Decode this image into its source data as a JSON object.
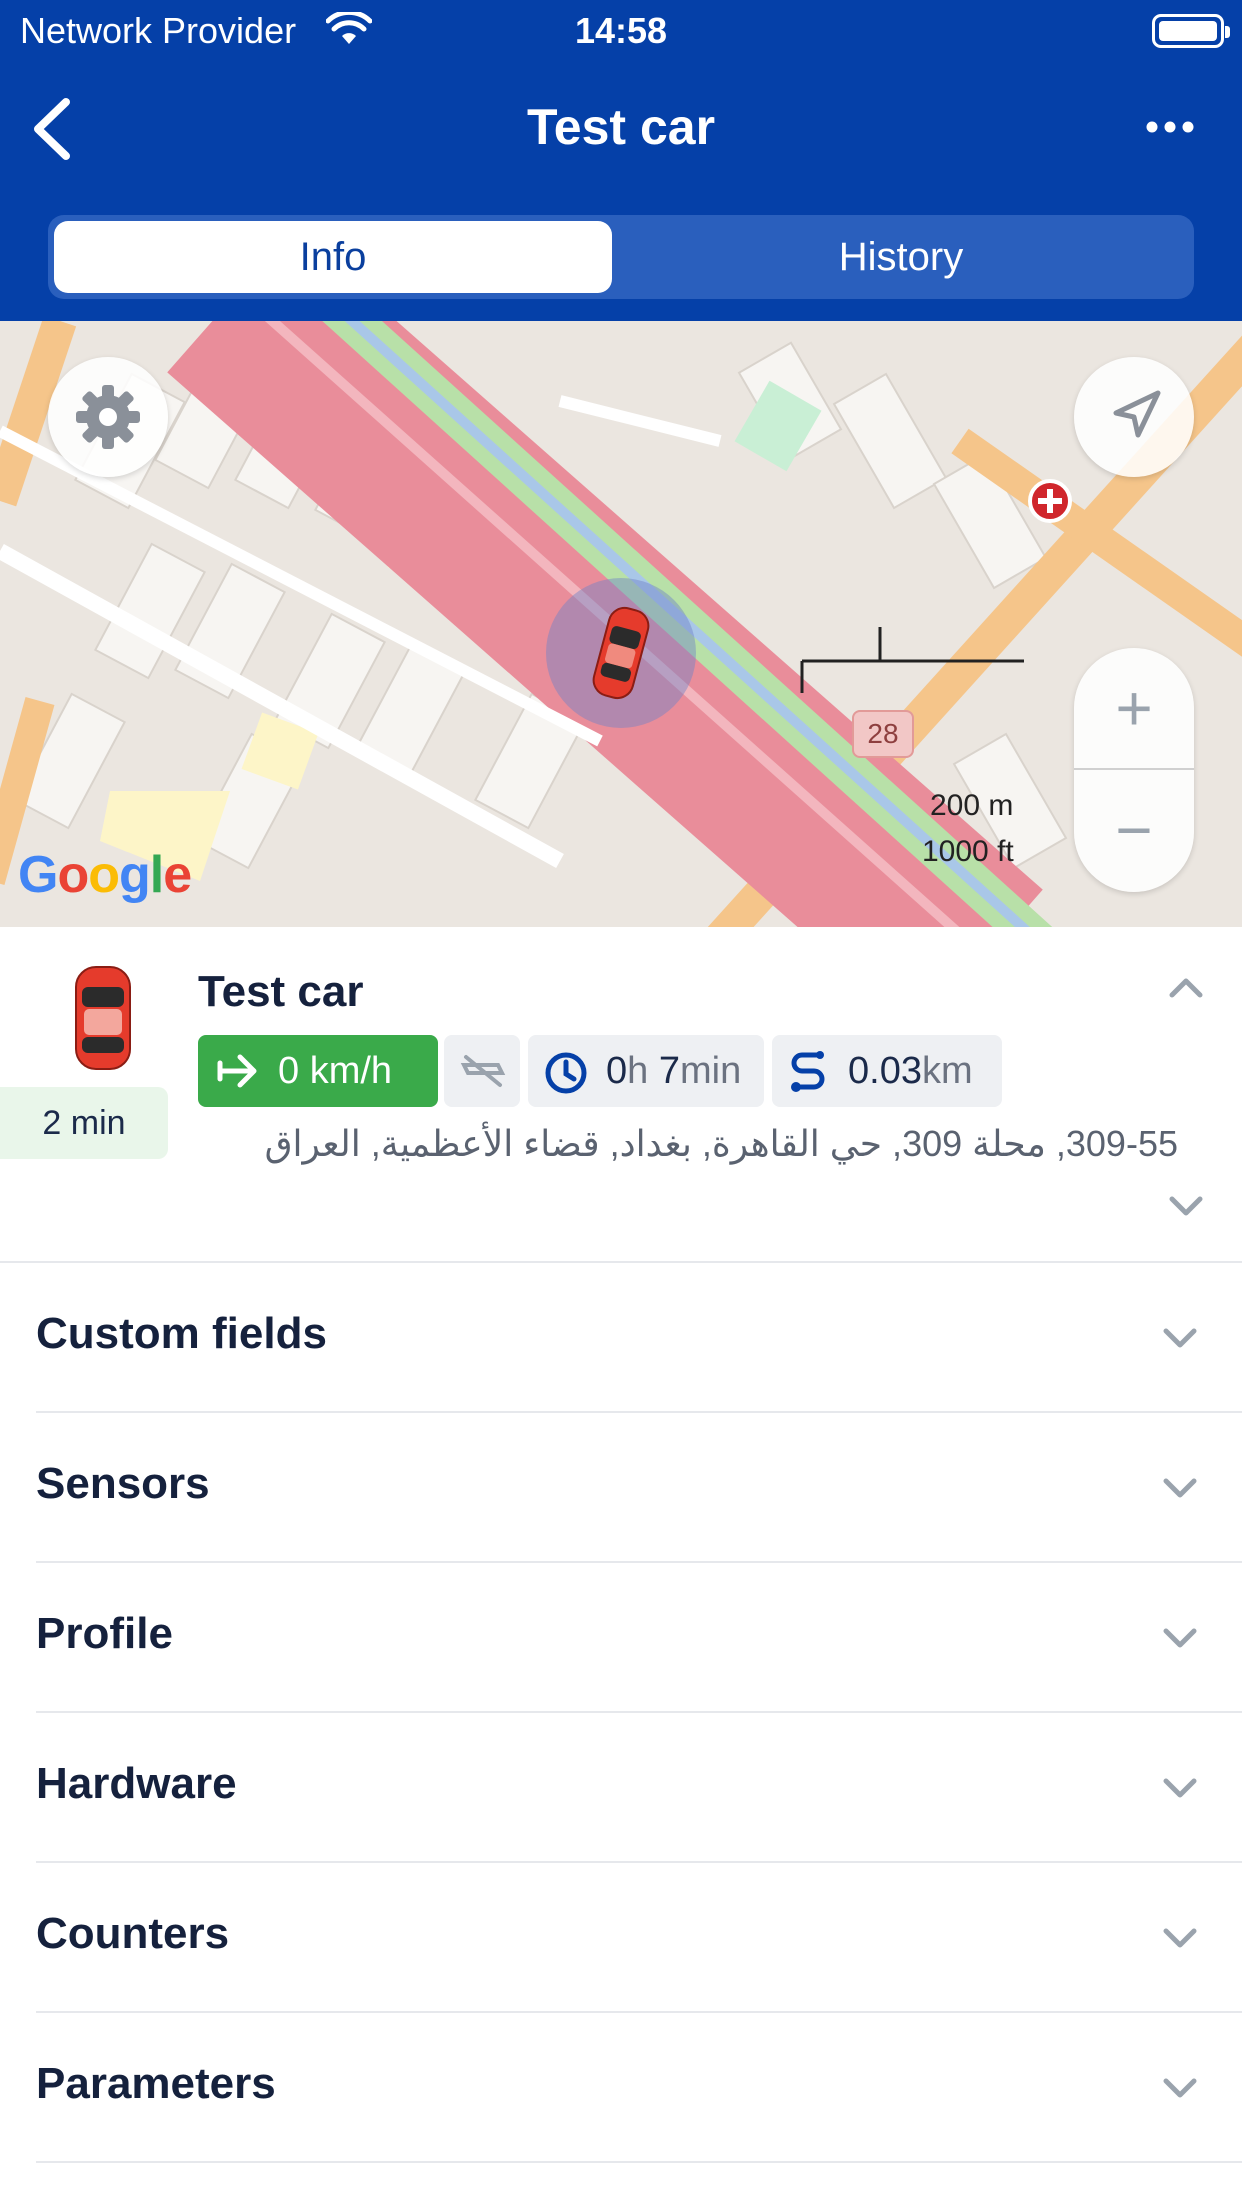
{
  "status_bar": {
    "carrier": "Network Provider",
    "time": "14:58"
  },
  "navbar": {
    "title": "Test car",
    "back_icon": "chevron-left-icon",
    "more_icon": "more-horizontal-icon"
  },
  "tabs": {
    "info": "Info",
    "history": "History",
    "active": "Info"
  },
  "map": {
    "provider_logo": "Google",
    "scale_metric": "200 m",
    "scale_imperial": "1000 ft",
    "road_badge": "28",
    "zoom_in": "+",
    "zoom_out": "−"
  },
  "device": {
    "name": "Test car",
    "last_update": "2 min",
    "speed": "0 km/h",
    "duration": {
      "hours": "0",
      "h_unit": "h",
      "minutes": "7",
      "min_unit": "min"
    },
    "distance": {
      "value": "0.03",
      "unit": "km"
    },
    "address": "309-55, محلة 309, حي القاهرة, بغداد, قضاء الأعظمية, العراق",
    "colors": {
      "speed_chip": "#3aaa4a",
      "header": "#0540a8"
    }
  },
  "sections": [
    {
      "label": "Custom fields"
    },
    {
      "label": "Sensors"
    },
    {
      "label": "Profile"
    },
    {
      "label": "Hardware"
    },
    {
      "label": "Counters"
    },
    {
      "label": "Parameters"
    }
  ]
}
